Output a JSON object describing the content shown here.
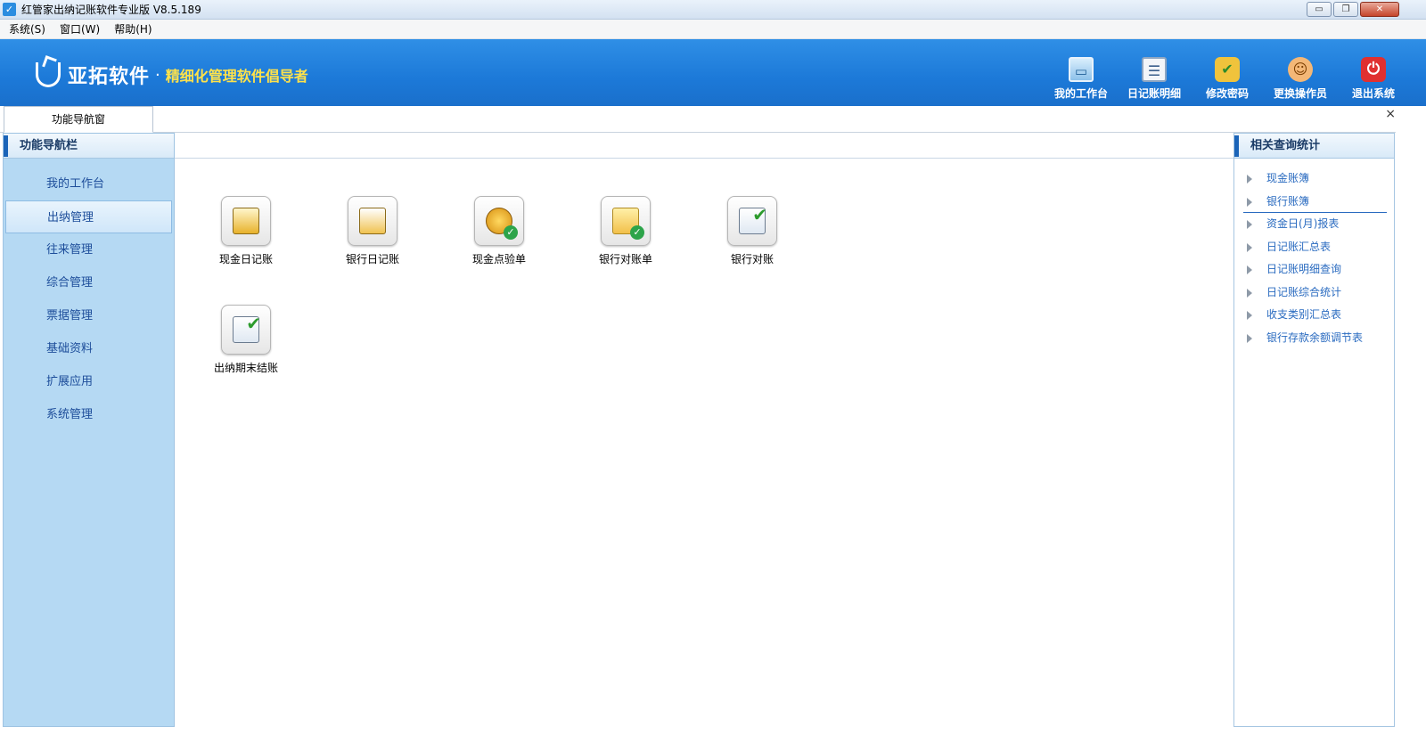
{
  "window": {
    "title": "红管家出纳记账软件专业版 V8.5.189",
    "controls": {
      "minimize": "▭",
      "restore": "❐",
      "close": "✕"
    }
  },
  "menubar": {
    "items": [
      "系统(S)",
      "窗口(W)",
      "帮助(H)"
    ]
  },
  "banner": {
    "logo_name": "亚拓软件",
    "logo_dot": "·",
    "slogan": "精细化管理软件倡导者",
    "toolbar": [
      {
        "label": "我的工作台",
        "icon": "monitor-icon"
      },
      {
        "label": "日记账明细",
        "icon": "list-icon"
      },
      {
        "label": "修改密码",
        "icon": "lock-icon"
      },
      {
        "label": "更换操作员",
        "icon": "user-icon"
      },
      {
        "label": "退出系统",
        "icon": "power-icon"
      }
    ]
  },
  "tabs": {
    "active": "功能导航窗",
    "close_glyph": "×"
  },
  "leftnav": {
    "title": "功能导航栏",
    "items": [
      {
        "label": "我的工作台"
      },
      {
        "label": "出纳管理",
        "active": true
      },
      {
        "label": "往来管理"
      },
      {
        "label": "综合管理"
      },
      {
        "label": "票据管理"
      },
      {
        "label": "基础资料"
      },
      {
        "label": "扩展应用"
      },
      {
        "label": "系统管理"
      }
    ]
  },
  "functions": [
    {
      "label": "现金日记账",
      "icon": "cash-journal-icon"
    },
    {
      "label": "银行日记账",
      "icon": "bank-journal-icon"
    },
    {
      "label": "现金点验单",
      "icon": "cash-check-icon"
    },
    {
      "label": "银行对账单",
      "icon": "bank-statement-icon"
    },
    {
      "label": "银行对账",
      "icon": "bank-reconcile-icon"
    },
    {
      "label": "出纳期末结账",
      "icon": "period-close-icon"
    }
  ],
  "rightpanel": {
    "title": "相关查询统计",
    "items": [
      "现金账簿",
      "银行账簿",
      "资金日(月)报表",
      "日记账汇总表",
      "日记账明细查询",
      "日记账综合统计",
      "收支类别汇总表",
      "银行存款余额调节表"
    ],
    "selected_index": 1
  }
}
